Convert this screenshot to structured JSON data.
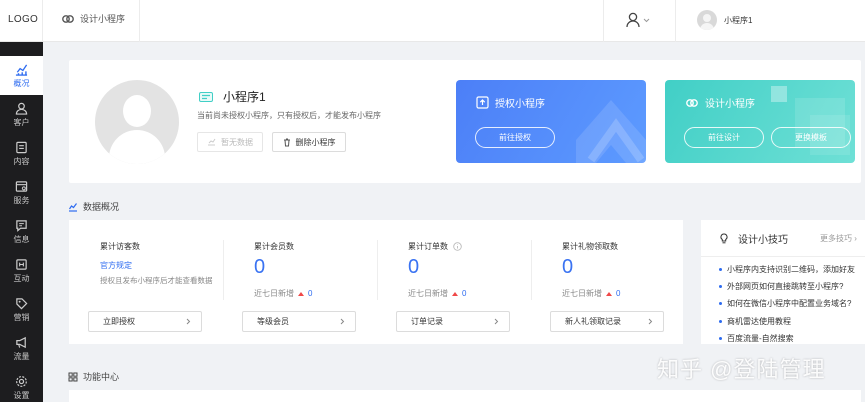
{
  "topbar": {
    "logo": "LOGO",
    "breadcrumb": "设计小程序",
    "account_name": "小程序1"
  },
  "sidebar": {
    "items": [
      {
        "label": "概况",
        "icon": "chart-icon",
        "active": true
      },
      {
        "label": "客户",
        "icon": "user-icon"
      },
      {
        "label": "内容",
        "icon": "document-icon"
      },
      {
        "label": "服务",
        "icon": "service-icon"
      },
      {
        "label": "信息",
        "icon": "message-icon"
      },
      {
        "label": "互动",
        "icon": "interact-icon"
      },
      {
        "label": "营销",
        "icon": "tag-icon"
      },
      {
        "label": "流量",
        "icon": "megaphone-icon"
      },
      {
        "label": "设置",
        "icon": "gear-icon"
      }
    ]
  },
  "hero": {
    "app_name": "小程序1",
    "description": "当前尚未授权小程序，只有授权后，才能发布小程序",
    "no_data_label": "暂无数据",
    "delete_label": "删除小程序"
  },
  "promo_authorize": {
    "title": "授权小程序",
    "button": "前往授权",
    "color": "#4c7ff7"
  },
  "promo_design": {
    "title": "设计小程序",
    "button_design": "前往设计",
    "button_template": "更换模板",
    "color": "#41cfc6"
  },
  "overview": {
    "title": "数据概况",
    "stats": [
      {
        "title": "累计访客数",
        "link": "官方规定",
        "note": "授权且发布小程序后才能查看数据",
        "button": "立即授权"
      },
      {
        "title": "累计会员数",
        "value": "0",
        "sub_label": "近七日新增",
        "sub_value": "0",
        "button": "等级会员"
      },
      {
        "title": "累计订单数",
        "value": "0",
        "sub_label": "近七日新增",
        "sub_value": "0",
        "button": "订单记录"
      },
      {
        "title": "累计礼物领取数",
        "value": "0",
        "sub_label": "近七日新增",
        "sub_value": "0",
        "button": "新人礼领取记录"
      }
    ]
  },
  "tips": {
    "title": "设计小技巧",
    "more": "更多技巧",
    "items": [
      "小程序内支持识别二维码，添加好友",
      "外部网页如何直接跳转至小程序?",
      "如何在微信小程序中配置业务域名?",
      "商机雷达使用教程",
      "百度流量-自然搜索"
    ]
  },
  "function_center": {
    "title": "功能中心"
  },
  "watermark": "知乎 @登陆管理"
}
